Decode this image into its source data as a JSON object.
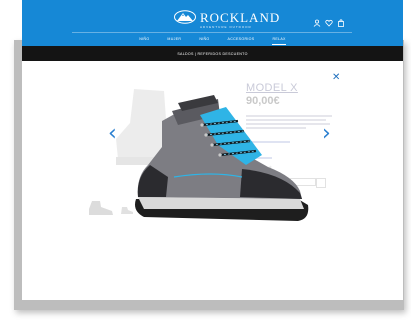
{
  "brand": {
    "name": "ROCKLAND",
    "tagline": "ADVENTURE OUTDOOR"
  },
  "nav": {
    "items": [
      "NIÑO",
      "MUJER",
      "NIÑO",
      "ACCESORIOS",
      "RELAX"
    ],
    "active_index": 4
  },
  "promo": "SALDOS | REFERIDOS DESCUENTO",
  "product": {
    "name": "MODEL X",
    "price": "90,00€"
  },
  "colors": {
    "header_blue": "#1688d6",
    "promo_black": "#141414",
    "accent_blue": "#2a7fd0",
    "shoe_accent": "#2fb4e6"
  },
  "icons": {
    "user": "user-icon",
    "wishlist": "heart-icon",
    "bag": "shopping-bag-icon",
    "close": "close-icon",
    "prev": "chevron-left-icon",
    "next": "chevron-right-icon"
  }
}
